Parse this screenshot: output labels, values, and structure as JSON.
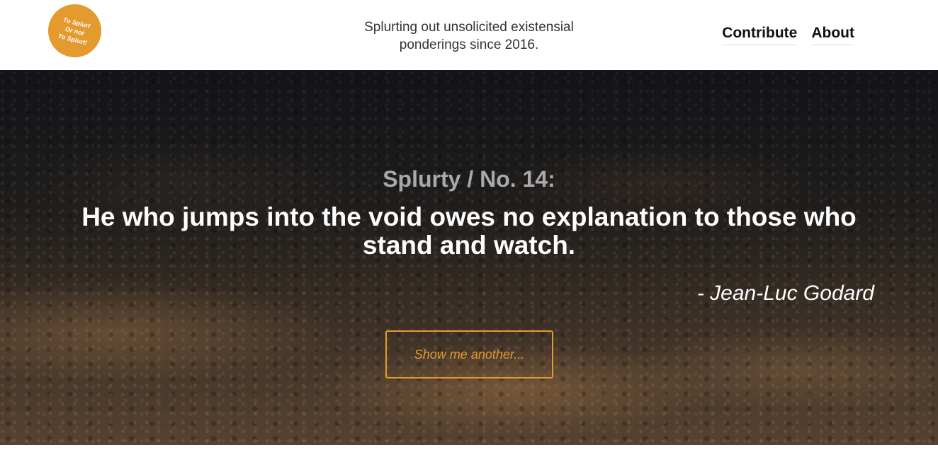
{
  "header": {
    "logo": {
      "lines": [
        "To Splurt",
        "Or not",
        "To Splurt!"
      ],
      "color": "#e39a2e"
    },
    "tagline": {
      "line1": "Splurting out unsolicited existensial",
      "line2": "ponderings since 2016."
    },
    "nav": {
      "contribute": "Contribute",
      "about": "About"
    }
  },
  "hero": {
    "subtitle": "Splurty / No. 14:",
    "quote": "He who jumps into the void owes no explanation to those who stand and watch.",
    "author": "- Jean-Luc Godard",
    "button_label": "Show me another...",
    "accent_color": "#e39a2e"
  }
}
